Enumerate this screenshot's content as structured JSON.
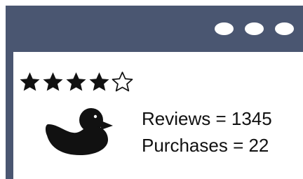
{
  "window": {
    "frame_color": "#4a5671",
    "controls": [
      "dot",
      "dot",
      "dot"
    ]
  },
  "product": {
    "icon": "duck-icon",
    "rating": 4,
    "rating_max": 5,
    "reviews_text": "Reviews = 1345",
    "purchases_text": "Purchases = 22"
  }
}
